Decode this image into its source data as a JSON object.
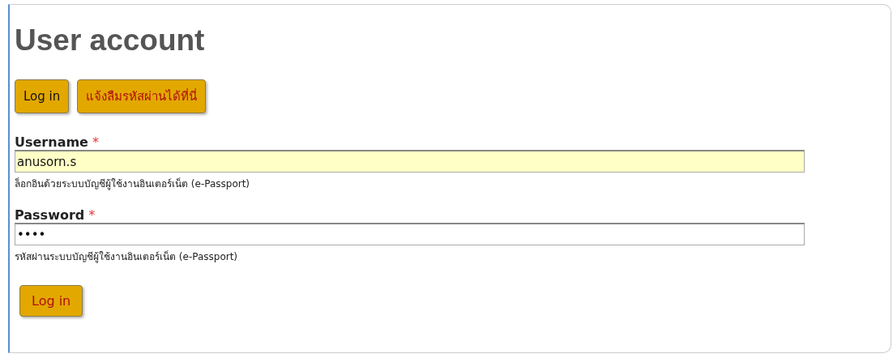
{
  "title": "User account",
  "tabs": [
    {
      "label": "Log in",
      "selected": true
    },
    {
      "label": "แจ้งลืมรหัสผ่านได้ที่นี่",
      "selected": false
    }
  ],
  "fields": [
    {
      "label": "Username",
      "required_mark": "*",
      "value": "anusorn.s",
      "highlighted": true,
      "description": "ล็อกอินด้วยระบบบัญชีผู้ใช้งานอินเตอร์เน็ต (e-Passport)"
    },
    {
      "label": "Password",
      "required_mark": "*",
      "value": "••••",
      "highlighted": false,
      "description": "รหัสผ่านระบบบัญชีผู้ใช้งานอินเตอร์เน็ต (e-Passport)"
    }
  ],
  "submit": "Log in"
}
